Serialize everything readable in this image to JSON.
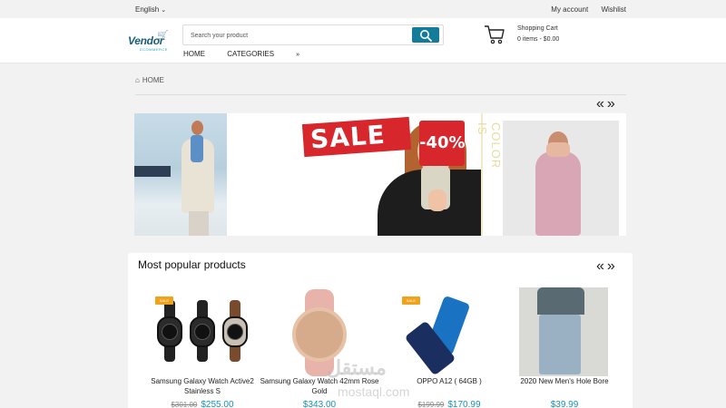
{
  "topbar": {
    "language": "English",
    "links": [
      "My account",
      "Wishlist"
    ]
  },
  "header": {
    "logo": {
      "brand": "Vendor",
      "tagline": "ECOMMERCE"
    },
    "search": {
      "placeholder": "Search your product",
      "value": ""
    },
    "nav": [
      "HOME",
      "CATEGORIES"
    ],
    "cart": {
      "title": "Shopping Cart",
      "summary": "0 items - $0.00"
    }
  },
  "breadcrumb": {
    "label": "HOME"
  },
  "slider_nav": {
    "prev": "«",
    "next": "»"
  },
  "banner": {
    "sale_text": "SALE",
    "discount_text": "-40%",
    "side_text": "COLOR IS"
  },
  "popular": {
    "title": "Most popular products",
    "nav": {
      "prev": "«",
      "next": "»"
    },
    "products": [
      {
        "name": "Samsung Galaxy Watch Active2 Stainless S",
        "price": "$255.00",
        "old_price": "$301.00",
        "badge": "SALE"
      },
      {
        "name": "Samsung Galaxy Watch 42mm Rose Gold",
        "price": "$343.00",
        "old_price": "",
        "badge": ""
      },
      {
        "name": "OPPO A12 ( 64GB )",
        "price": "$170.99",
        "old_price": "$199.99",
        "badge": "SALE"
      },
      {
        "name": "2020 New Men's Hole Bore",
        "price": "$39.99",
        "old_price": "",
        "badge": ""
      }
    ]
  },
  "watermark": {
    "line1": "مستقل",
    "line2": "mostaql.com"
  },
  "colors": {
    "accent": "#137c9a",
    "price": "#1990b6",
    "sale_badge": "#f0a21b",
    "sale_red": "#d7262c"
  },
  "icons": [
    "chevron-down-icon",
    "search-icon",
    "cart-icon",
    "home-icon"
  ]
}
